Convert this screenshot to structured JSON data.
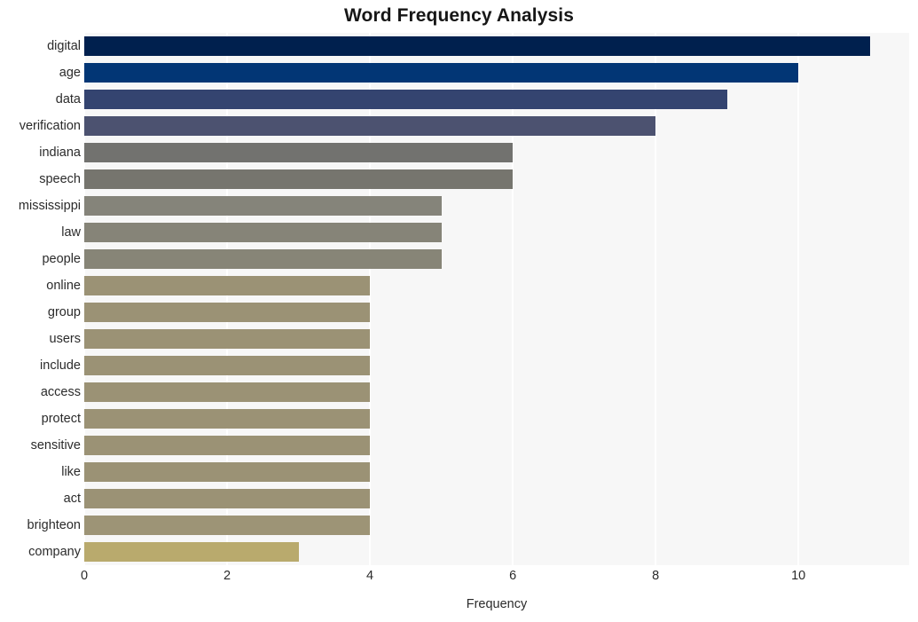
{
  "chart_data": {
    "type": "bar",
    "orientation": "horizontal",
    "title": "Word Frequency Analysis",
    "xlabel": "Frequency",
    "ylabel": "",
    "xlim": [
      0,
      11.55
    ],
    "xticks": [
      0,
      2,
      4,
      6,
      8,
      10
    ],
    "xtick_labels": [
      "0",
      "2",
      "4",
      "6",
      "8",
      "10"
    ],
    "grid": true,
    "grid_axis": "x",
    "grid_color": "#ffffff",
    "plot_background": "#f7f7f7",
    "figure_background": "#ffffff",
    "legend": null,
    "categories": [
      "digital",
      "age",
      "data",
      "verification",
      "indiana",
      "speech",
      "mississippi",
      "law",
      "people",
      "online",
      "group",
      "users",
      "include",
      "access",
      "protect",
      "sensitive",
      "like",
      "act",
      "brighteon",
      "company"
    ],
    "values": [
      11,
      10,
      9,
      8,
      6,
      6,
      5,
      5,
      5,
      4,
      4,
      4,
      4,
      4,
      4,
      4,
      4,
      4,
      4,
      3
    ],
    "bar_colors": [
      "#00204e",
      "#023675",
      "#344470",
      "#4c5270",
      "#72726f",
      "#76756e",
      "#85847a",
      "#868478",
      "#878577",
      "#9b9275",
      "#9b9275",
      "#9b9275",
      "#9b9275",
      "#9b9275",
      "#9b9275",
      "#9b9275",
      "#9b9275",
      "#9b9275",
      "#9d9476",
      "#b9aa6d"
    ]
  }
}
